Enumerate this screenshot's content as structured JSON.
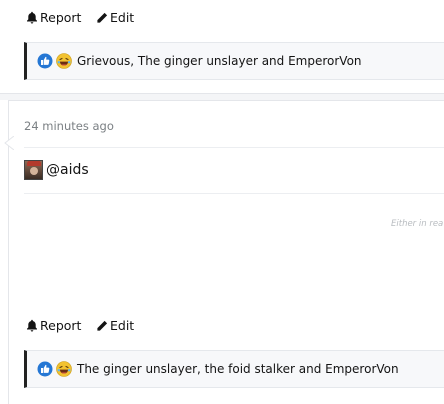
{
  "post1": {
    "report_label": "Report",
    "edit_label": "Edit",
    "reactions_text": "Grievous, The ginger unslayer and EmperorVon"
  },
  "post2": {
    "timestamp": "24 minutes ago",
    "mention": "@aids",
    "faint_text": "Either in rea",
    "report_label": "Report",
    "edit_label": "Edit",
    "reactions_text": "The ginger unslayer, the foid stalker and EmperorVon"
  },
  "icons": {
    "report": "bell-icon",
    "edit": "pencil-icon",
    "like": "thumbs-up-icon",
    "laugh": "laughing-face-icon"
  },
  "colors": {
    "like_blue": "#2577d4",
    "laugh_yellow": "#f2c230",
    "reaction_border": "#222222"
  }
}
